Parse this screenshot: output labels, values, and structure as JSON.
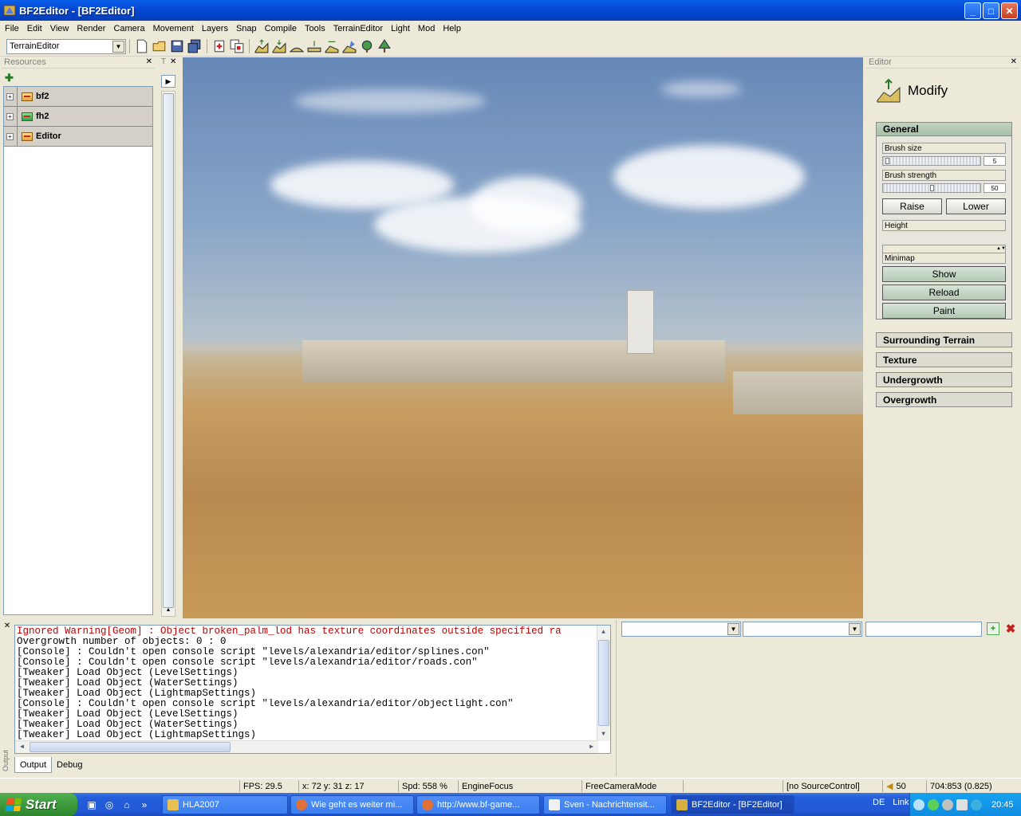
{
  "window": {
    "title": "BF2Editor - [BF2Editor]",
    "btn_min": "_",
    "btn_max": "□",
    "btn_close": "✕"
  },
  "menu": [
    "File",
    "Edit",
    "View",
    "Render",
    "Camera",
    "Movement",
    "Layers",
    "Snap",
    "Compile",
    "Tools",
    "TerrainEditor",
    "Light",
    "Mod",
    "Help"
  ],
  "toolbar": {
    "editor_mode": "TerrainEditor"
  },
  "resources": {
    "title": "Resources",
    "close": "✕",
    "add": "✚",
    "items": [
      {
        "label": "bf2",
        "icon": "folder-icon"
      },
      {
        "label": "fh2",
        "icon": "folder-green-icon"
      },
      {
        "label": "Editor",
        "icon": "folder-icon"
      }
    ]
  },
  "narrow_panel": {
    "title": "T",
    "close": "✕",
    "expand": "▶",
    "scroll_up": "▲"
  },
  "editor": {
    "title": "Editor",
    "close": "✕",
    "mode": "Modify",
    "general": {
      "title": "General",
      "brush_size_label": "Brush size",
      "brush_size_value": "5",
      "brush_size_fraction": 0.02,
      "brush_strength_label": "Brush strength",
      "brush_strength_value": "50",
      "brush_strength_fraction": 0.5,
      "raise": "Raise",
      "lower": "Lower",
      "height_label": "Height",
      "spin": "▲▼",
      "minimap_label": "Minimap",
      "show": "Show",
      "reload": "Reload",
      "paint": "Paint"
    },
    "sections": [
      "Surrounding Terrain",
      "Texture",
      "Undergrowth",
      "Overgrowth"
    ]
  },
  "output": {
    "close": "✕",
    "side_label": "Output",
    "lines": [
      {
        "text": "Ignored Warning[Geom] : Object broken_palm_lod has texture coordinates outside specified ra",
        "warn": true
      },
      {
        "text": "Overgrowth number of objects: 0 : 0",
        "warn": false
      },
      {
        "text": "[Console] : Couldn't open console script \"levels/alexandria/editor/splines.con\"",
        "warn": false
      },
      {
        "text": "[Console] : Couldn't open console script \"levels/alexandria/editor/roads.con\"",
        "warn": false
      },
      {
        "text": "[Tweaker] Load Object (LevelSettings)",
        "warn": false
      },
      {
        "text": "[Tweaker] Load Object (WaterSettings)",
        "warn": false
      },
      {
        "text": "[Tweaker] Load Object (LightmapSettings)",
        "warn": false
      },
      {
        "text": "[Console] : Couldn't open console script \"levels/alexandria/editor/objectlight.con\"",
        "warn": false
      },
      {
        "text": "[Tweaker] Load Object (LevelSettings)",
        "warn": false
      },
      {
        "text": "[Tweaker] Load Object (WaterSettings)",
        "warn": false
      },
      {
        "text": "[Tweaker] Load Object (LightmapSettings)",
        "warn": false
      }
    ],
    "tabs": [
      "Output",
      "Debug"
    ],
    "arrow_up": "▲",
    "arrow_down": "▼",
    "arrow_left": "◀",
    "arrow_right": "▶"
  },
  "right_pane": {
    "combo_arrow": "▼",
    "add_icon": "+",
    "delete_icon": "✖"
  },
  "status": {
    "fps": "FPS: 29.5",
    "coords": "x: 72 y: 31 z: 17",
    "speed": "Spd: 558 %",
    "focus": "EngineFocus",
    "camera": "FreeCameraMode",
    "source_control": "[no SourceControl]",
    "volume": "50",
    "resolution": "704:853 (0.825)"
  },
  "taskbar": {
    "start": "Start",
    "quicklaunch_more": "»",
    "tasks": [
      {
        "label": "HLA2007",
        "color": "#e8c050"
      },
      {
        "label": "Wie geht es weiter mi...",
        "color": "#e0703a"
      },
      {
        "label": "http://www.bf-game...",
        "color": "#e0703a"
      },
      {
        "label": "Sven - Nachrichtensit...",
        "color": "#f0f0f0"
      },
      {
        "label": "BF2Editor - [BF2Editor]",
        "color": "#d8b040"
      }
    ],
    "lang": "DE",
    "links": "Links",
    "clock": "20:45"
  }
}
